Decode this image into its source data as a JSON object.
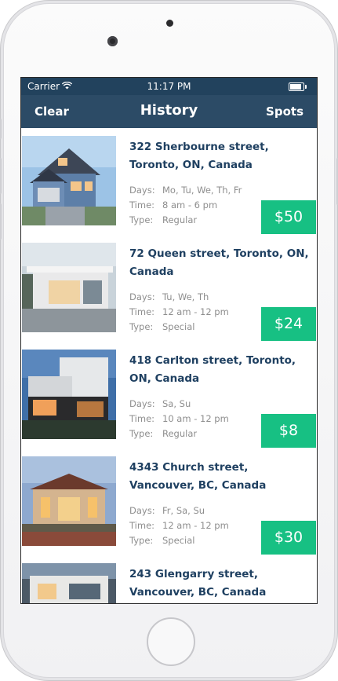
{
  "status_bar": {
    "carrier": "Carrier",
    "time": "11:17 PM"
  },
  "nav": {
    "left_label": "Clear",
    "title": "History",
    "right_label": "Spots"
  },
  "labels": {
    "days": "Days:",
    "time": "Time:",
    "type": "Type:"
  },
  "colors": {
    "nav_bg": "#2c4b66",
    "status_bg": "#22425d",
    "price_bg": "#17c083",
    "address_text": "#1f4061"
  },
  "listings": [
    {
      "address": "322 Sherbourne street, Toronto, ON, Canada",
      "days": "Mo, Tu, We, Th, Fr",
      "time": "8 am - 6 pm",
      "type": "Regular",
      "price": "$50"
    },
    {
      "address": "72 Queen street, Toronto, ON, Canada",
      "days": "Tu, We, Th",
      "time": "12 am - 12 pm",
      "type": "Special",
      "price": "$24"
    },
    {
      "address": "418 Carlton street, Toronto, ON, Canada",
      "days": "Sa, Su",
      "time": "10 am - 12 pm",
      "type": "Regular",
      "price": "$8"
    },
    {
      "address": "4343 Church street, Vancouver, BC, Canada",
      "days": "Fr, Sa, Su",
      "time": "12 am - 12 pm",
      "type": "Special",
      "price": "$30"
    },
    {
      "address": "243 Glengarry street, Vancouver, BC, Canada",
      "days": "",
      "time": "",
      "type": "",
      "price": ""
    }
  ]
}
